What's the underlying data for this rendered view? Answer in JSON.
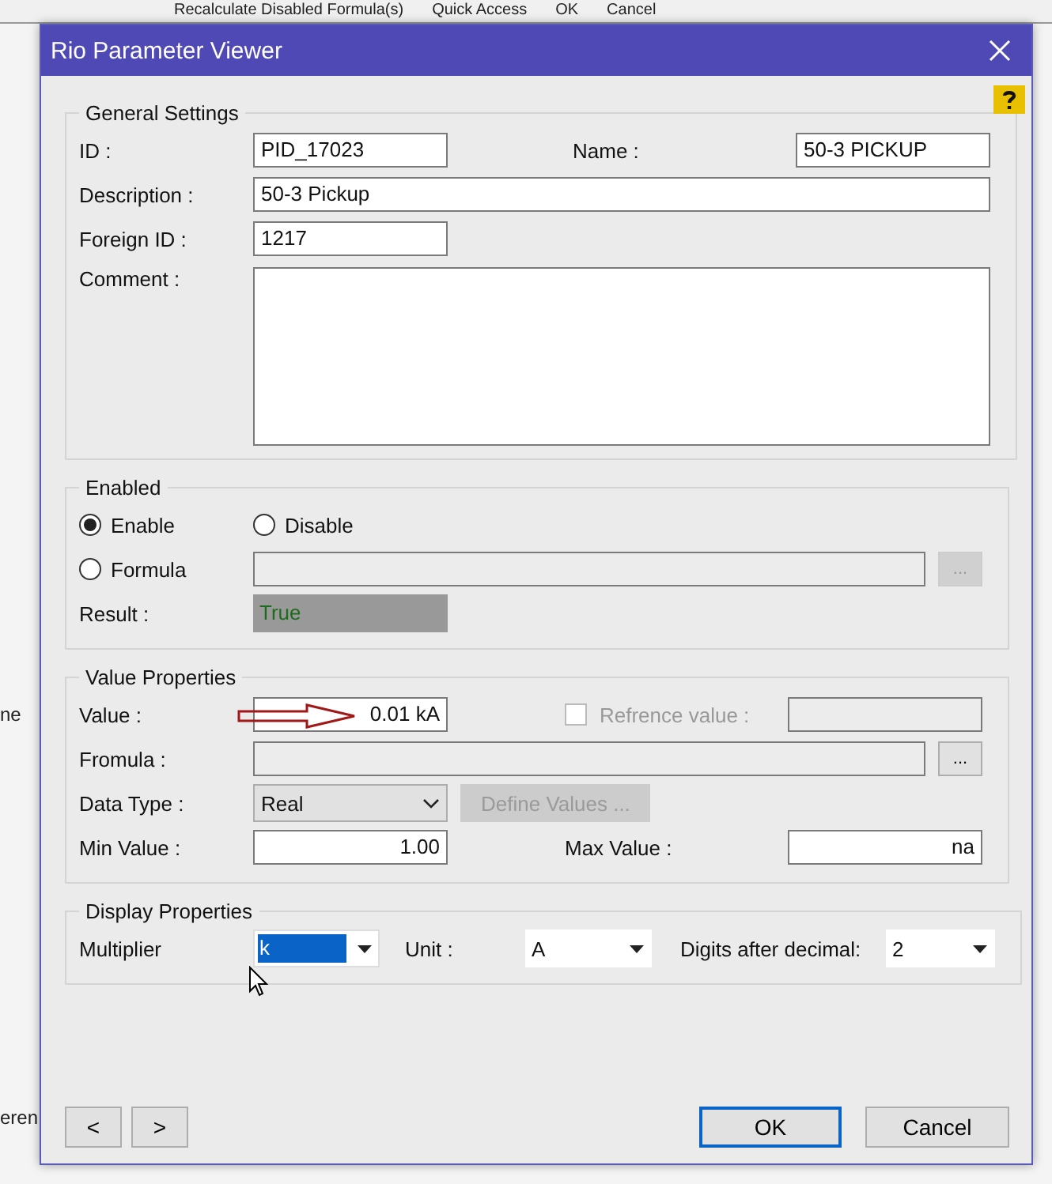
{
  "background": {
    "toolbar": [
      "Recalculate Disabled Formula(s)",
      "Quick Access",
      "OK",
      "Cancel"
    ],
    "side_texts": [
      "ne",
      "eren"
    ]
  },
  "dialog": {
    "title": "Rio Parameter Viewer",
    "general": {
      "title": "General Settings",
      "id_label": "ID :",
      "id": "PID_17023",
      "name_label": "Name :",
      "name": "50-3 PICKUP",
      "description_label": "Description :",
      "description": "50-3 Pickup",
      "foreign_id_label": "Foreign ID :",
      "foreign_id": "1217",
      "comment_label": "Comment :"
    },
    "enabled": {
      "title": "Enabled",
      "options": [
        {
          "label": "Enable",
          "selected": true
        },
        {
          "label": "Disable",
          "selected": false
        },
        {
          "label": "Formula",
          "selected": false
        }
      ],
      "formula_button": {
        "label": "...",
        "disabled": true
      },
      "result_label": "Result :",
      "result": "True"
    },
    "value_properties": {
      "title": "Value Properties",
      "value_label": "Value :",
      "value": "0.01 kA",
      "reference": {
        "label": "Refrence value :",
        "checked": false,
        "disabled": true
      },
      "formula_label": "Fromula :",
      "formula_button": {
        "label": "...",
        "disabled": false
      },
      "data_type_label": "Data Type :",
      "data_type": "Real",
      "define_values": {
        "label": "Define Values ...",
        "disabled": true
      },
      "min_label": "Min Value :",
      "min": "1.00",
      "max_label": "Max Value :",
      "max": "na"
    },
    "display": {
      "title": "Display Properties",
      "multiplier_label": "Multiplier",
      "multiplier": "k",
      "unit_label": "Unit :",
      "unit": "A",
      "digits_label": "Digits after decimal:",
      "digits": "2"
    },
    "nav_buttons": [
      "<",
      ">"
    ],
    "ok": "OK",
    "cancel": "Cancel"
  }
}
